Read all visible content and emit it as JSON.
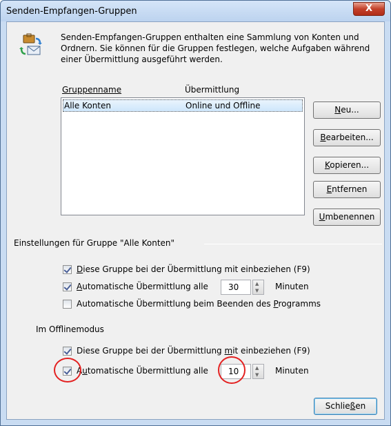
{
  "window": {
    "title": "Senden-Empfangen-Gruppen",
    "close_label": "X"
  },
  "description": "Senden-Empfangen-Gruppen enthalten eine Sammlung von Konten und Ordnern. Sie können für die Gruppen festlegen, welche Aufgaben während einer Übermittlung ausgeführt werden.",
  "list": {
    "columns": [
      "Gruppenname",
      "Übermittlung"
    ],
    "rows": [
      {
        "name": "Alle Konten",
        "transfer": "Online und Offline",
        "selected": true
      }
    ]
  },
  "buttons": {
    "new": {
      "access": "N",
      "rest": "eu..."
    },
    "edit": {
      "access": "B",
      "rest": "earbeiten..."
    },
    "copy": {
      "access": "K",
      "rest": "opieren..."
    },
    "remove": {
      "access": "E",
      "rest": "ntfernen"
    },
    "rename": {
      "access": "U",
      "rest": "mbenennen"
    },
    "close": {
      "pre": "Schlie",
      "access": "ß",
      "post": "en"
    }
  },
  "settings_group": {
    "label": "Einstellungen für Gruppe \"Alle Konten\"",
    "online": {
      "include": {
        "checked": true,
        "access": "D",
        "rest": "iese Gruppe bei der Übermittlung mit einbeziehen (F9)"
      },
      "auto": {
        "checked": true,
        "access": "A",
        "rest": "utomatische Übermittlung alle",
        "minutes_value": "30",
        "unit": "Minuten"
      },
      "on_exit": {
        "checked": false,
        "pre": "Automatische Übermittlung beim Beenden des ",
        "access": "P",
        "post": "rogramms"
      }
    },
    "offline_label": "Im Offlinemodus",
    "offline": {
      "include": {
        "checked": true,
        "pre": "Diese Gruppe bei der Übermittlung ",
        "access": "m",
        "post": "it einbeziehen (F9)"
      },
      "auto": {
        "checked": true,
        "pre": "A",
        "access": "u",
        "post": "tomatische Übermittlung alle",
        "minutes_value": "10",
        "unit": "Minuten"
      }
    }
  },
  "colors": {
    "highlight_circle": "#e32020",
    "selection": "#cde6fb",
    "titlebar": "#bcd3ef"
  }
}
